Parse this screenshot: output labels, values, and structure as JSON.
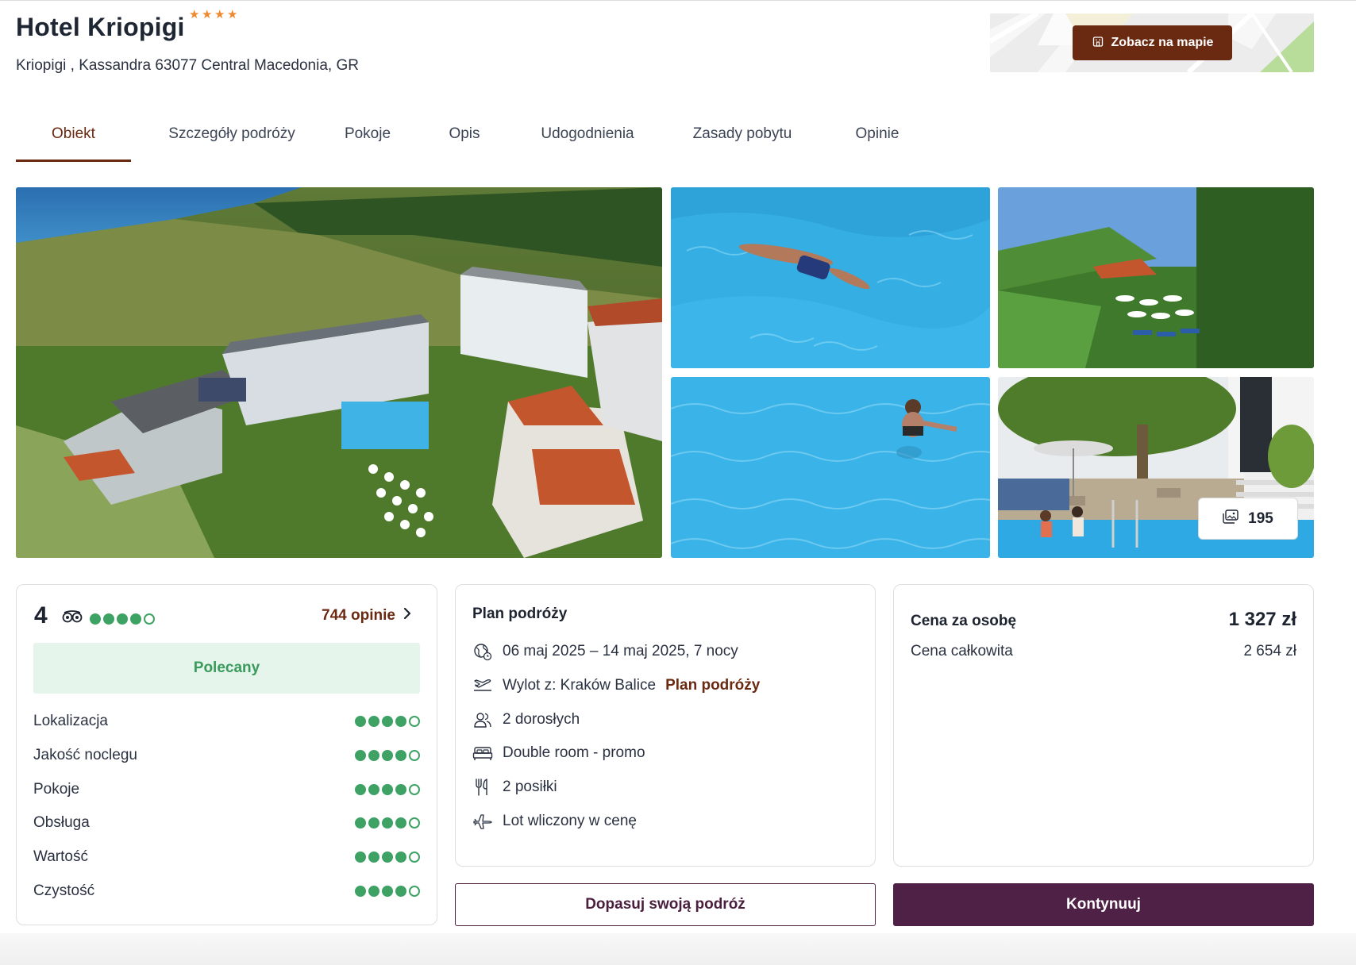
{
  "hotel": {
    "name": "Hotel Kriopigi",
    "stars": 4,
    "address": "Kriopigi , Kassandra 63077 Central Macedonia, GR",
    "map_button": "Zobacz na mapie"
  },
  "tabs": [
    {
      "label": "Obiekt",
      "active": true
    },
    {
      "label": "Szczegóły podróży",
      "active": false
    },
    {
      "label": "Pokoje",
      "active": false
    },
    {
      "label": "Opis",
      "active": false
    },
    {
      "label": "Udogodnienia",
      "active": false
    },
    {
      "label": "Zasady pobytu",
      "active": false
    },
    {
      "label": "Opinie",
      "active": false
    }
  ],
  "gallery": {
    "photo_count": "195",
    "photos": [
      "hotel-aerial",
      "pool-swimmer-1",
      "garden-umbrellas",
      "pool-swimmer-2",
      "pool-terrace"
    ]
  },
  "rating": {
    "score": "4",
    "score_value": 4,
    "score_max": 5,
    "reviews_label": "744 opinie",
    "badge": "Polecany",
    "categories": [
      {
        "label": "Lokalizacja",
        "value": 4
      },
      {
        "label": "Jakość noclegu",
        "value": 4
      },
      {
        "label": "Pokoje",
        "value": 4
      },
      {
        "label": "Obsługa",
        "value": 4
      },
      {
        "label": "Wartość",
        "value": 4
      },
      {
        "label": "Czystość",
        "value": 4
      }
    ]
  },
  "plan": {
    "title": "Plan podróży",
    "dates": "06 maj 2025 – 14 maj 2025, 7 nocy",
    "departure": "Wylot z: Kraków Balice",
    "departure_link": "Plan podróży",
    "travelers": "2 dorosłych",
    "room": "Double room - promo",
    "meals": "2 posiłki",
    "flight": "Lot wliczony w cenę"
  },
  "price": {
    "per_person_label": "Cena za osobę",
    "per_person_value": "1 327 zł",
    "total_label": "Cena całkowita",
    "total_value": "2 654 zł"
  },
  "actions": {
    "customize": "Dopasuj swoją podróż",
    "continue": "Kontynuuj"
  },
  "colors": {
    "brand_brown": "#6a2a12",
    "brand_plum": "#4f2146",
    "tripadvisor_green": "#3da264",
    "star_orange": "#f08a2e"
  }
}
